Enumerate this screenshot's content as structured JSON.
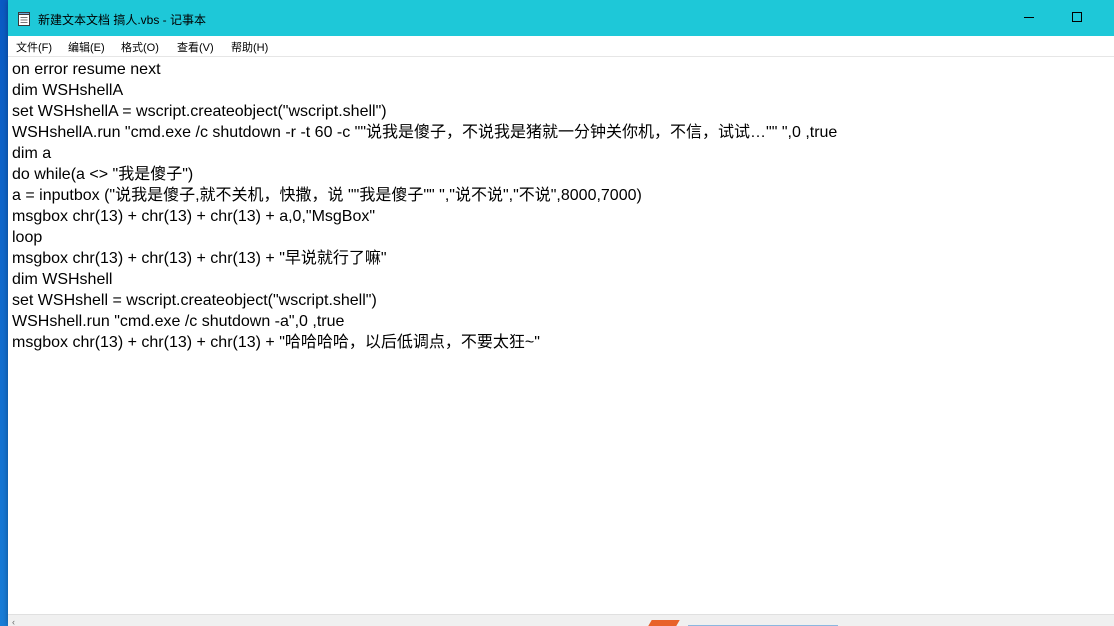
{
  "window": {
    "title": "新建文本文档 搞人.vbs - 记事本",
    "app_icon": "notepad-icon",
    "minimize_icon": "minimize-icon",
    "maximize_icon": "maximize-icon"
  },
  "menu": {
    "items": [
      {
        "label": "文件(F)"
      },
      {
        "label": "编辑(E)"
      },
      {
        "label": "格式(O)"
      },
      {
        "label": "查看(V)"
      },
      {
        "label": "帮助(H)"
      }
    ]
  },
  "editor": {
    "lines": [
      "on error resume next",
      "dim WSHshellA",
      "set WSHshellA = wscript.createobject(\"wscript.shell\")",
      "WSHshellA.run \"cmd.exe /c shutdown -r -t 60 -c \"\"说我是傻子，不说我是猪就一分钟关你机，不信，试试…\"\" \",0 ,true",
      "dim a",
      "do while(a <> \"我是傻子\")",
      "a = inputbox (\"说我是傻子,就不关机，快撒，说 \"\"我是傻子\"\" \",\"说不说\",\"不说\",8000,7000)",
      "msgbox chr(13) + chr(13) + chr(13) + a,0,\"MsgBox\"",
      "loop",
      "msgbox chr(13) + chr(13) + chr(13) + \"早说就行了嘛\"",
      "dim WSHshell",
      "set WSHshell = wscript.createobject(\"wscript.shell\")",
      "WSHshell.run \"cmd.exe /c shutdown -a\",0 ,true",
      "msgbox chr(13) + chr(13) + chr(13) + \"哈哈哈哈，以后低调点，不要太狂~\""
    ]
  },
  "scrollbar": {
    "left_arrow_icon": "scroll-left-arrow-icon",
    "left_arrow_glyph": "‹"
  },
  "colors": {
    "titlebar": "#1ec8d8",
    "desktop": "#1a73c8",
    "editor_bg": "#ffffff"
  }
}
